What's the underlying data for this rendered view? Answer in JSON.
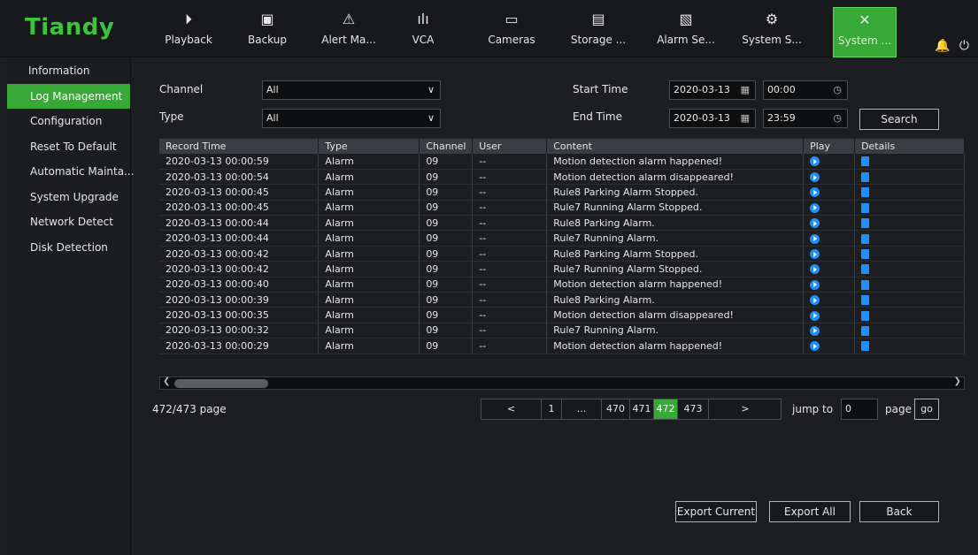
{
  "logo": "Tiandy",
  "nav": [
    {
      "label": "Playback",
      "icon": "playback-icon",
      "glyph": "⏵"
    },
    {
      "label": "Backup",
      "icon": "save-icon",
      "glyph": "▣"
    },
    {
      "label": "Alert Ma...",
      "icon": "alert-icon",
      "glyph": "⚠"
    },
    {
      "label": "VCA",
      "icon": "vca-icon",
      "glyph": "ılı"
    },
    {
      "label": "Cameras",
      "icon": "camera-icon",
      "glyph": "▭"
    },
    {
      "label": "Storage ...",
      "icon": "storage-icon",
      "glyph": "▤"
    },
    {
      "label": "Alarm Se...",
      "icon": "alarm-icon",
      "glyph": "▧"
    },
    {
      "label": "System S...",
      "icon": "system-settings-icon",
      "glyph": "⚙"
    },
    {
      "label": "System ...",
      "icon": "tools-icon",
      "glyph": "✕"
    }
  ],
  "top_icons": {
    "bell": "🔔",
    "power": "⏻"
  },
  "sidebar": [
    {
      "label": "Information"
    },
    {
      "label": "Log Management"
    },
    {
      "label": "Configuration"
    },
    {
      "label": "Reset To Default"
    },
    {
      "label": "Automatic Mainta..."
    },
    {
      "label": "System Upgrade"
    },
    {
      "label": "Network Detect"
    },
    {
      "label": "Disk Detection"
    }
  ],
  "filters": {
    "channel_label": "Channel",
    "channel_value": "All",
    "type_label": "Type",
    "type_value": "All",
    "start_label": "Start Time",
    "start_date": "2020-03-13",
    "start_time": "00:00",
    "end_label": "End Time",
    "end_date": "2020-03-13",
    "end_time": "23:59",
    "search_label": "Search"
  },
  "table": {
    "headers": [
      "Record Time",
      "Type",
      "Channel",
      "User",
      "Content",
      "Play",
      "Details"
    ],
    "rows": [
      [
        "2020-03-13 00:00:59",
        "Alarm",
        "09",
        "--",
        "Motion detection alarm happened!"
      ],
      [
        "2020-03-13 00:00:54",
        "Alarm",
        "09",
        "--",
        "Motion detection alarm disappeared!"
      ],
      [
        "2020-03-13 00:00:45",
        "Alarm",
        "09",
        "--",
        "Rule8 Parking Alarm Stopped."
      ],
      [
        "2020-03-13 00:00:45",
        "Alarm",
        "09",
        "--",
        "Rule7 Running Alarm Stopped."
      ],
      [
        "2020-03-13 00:00:44",
        "Alarm",
        "09",
        "--",
        "Rule8 Parking Alarm."
      ],
      [
        "2020-03-13 00:00:44",
        "Alarm",
        "09",
        "--",
        "Rule7 Running Alarm."
      ],
      [
        "2020-03-13 00:00:42",
        "Alarm",
        "09",
        "--",
        "Rule8 Parking Alarm Stopped."
      ],
      [
        "2020-03-13 00:00:42",
        "Alarm",
        "09",
        "--",
        "Rule7 Running Alarm Stopped."
      ],
      [
        "2020-03-13 00:00:40",
        "Alarm",
        "09",
        "--",
        "Motion detection alarm happened!"
      ],
      [
        "2020-03-13 00:00:39",
        "Alarm",
        "09",
        "--",
        "Rule8 Parking Alarm."
      ],
      [
        "2020-03-13 00:00:35",
        "Alarm",
        "09",
        "--",
        "Motion detection alarm disappeared!"
      ],
      [
        "2020-03-13 00:00:32",
        "Alarm",
        "09",
        "--",
        "Rule7 Running Alarm."
      ],
      [
        "2020-03-13 00:00:29",
        "Alarm",
        "09",
        "--",
        "Motion detection alarm happened!"
      ]
    ]
  },
  "pagination": {
    "status": "472/473 page",
    "prev": "<",
    "first": "1",
    "ellipsis": "...",
    "pages": [
      "470",
      "471",
      "472",
      "473"
    ],
    "current": "472",
    "next": ">",
    "jump_label": "jump to",
    "jump_value": "0",
    "page_label": "page",
    "go_label": "go"
  },
  "actions": {
    "export_current": "Export Current",
    "export_all": "Export All",
    "back": "Back"
  },
  "colors": {
    "accent": "#38a836",
    "logo": "#3fc33d",
    "play": "#1f8fff"
  }
}
